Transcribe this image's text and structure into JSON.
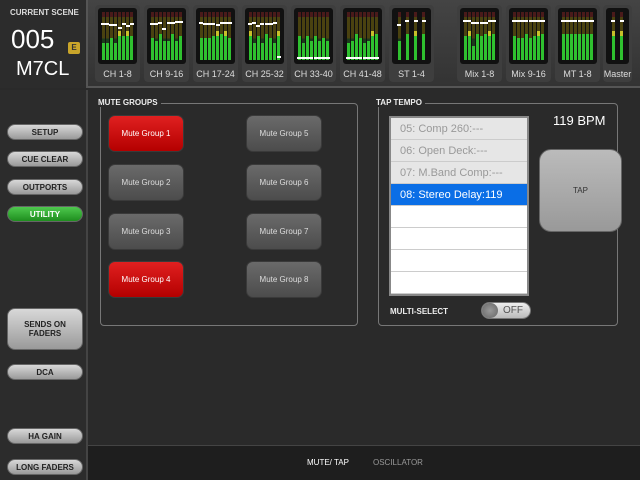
{
  "scene": {
    "label": "CURRENT SCENE",
    "number": "005",
    "badge": "E",
    "name": "M7CL"
  },
  "meters": [
    {
      "label": "CH 1-8",
      "levels": [
        0.35,
        0.35,
        0.45,
        0.35,
        0.6,
        0.5,
        0.6,
        0.5
      ],
      "faders": [
        0.72,
        0.72,
        0.7,
        0.7,
        0.65,
        0.72,
        0.68,
        0.72
      ]
    },
    {
      "label": "CH 9-16",
      "levels": [
        0.45,
        0.4,
        0.55,
        0.4,
        0.4,
        0.55,
        0.4,
        0.5
      ],
      "faders": [
        0.72,
        0.72,
        0.74,
        0.62,
        0.74,
        0.74,
        0.78,
        0.78
      ]
    },
    {
      "label": "CH 17-24",
      "levels": [
        0.45,
        0.45,
        0.45,
        0.5,
        0.6,
        0.55,
        0.6,
        0.45
      ],
      "faders": [
        0.74,
        0.72,
        0.72,
        0.72,
        0.7,
        0.74,
        0.76,
        0.74
      ]
    },
    {
      "label": "CH 25-32",
      "levels": [
        0.6,
        0.35,
        0.5,
        0.35,
        0.55,
        0.45,
        0.35,
        0.6
      ],
      "faders": [
        0.72,
        0.74,
        0.68,
        0.72,
        0.72,
        0.72,
        0.74,
        0.05
      ]
    },
    {
      "label": "CH 33-40",
      "levels": [
        0.5,
        0.35,
        0.5,
        0.4,
        0.5,
        0.4,
        0.45,
        0.4
      ],
      "faders": [
        0.02,
        0.02,
        0.02,
        0.02,
        0.02,
        0.02,
        0.02,
        0.02
      ]
    },
    {
      "label": "CH 41-48",
      "levels": [
        0.35,
        0.4,
        0.55,
        0.45,
        0.35,
        0.4,
        0.6,
        0.55
      ],
      "faders": [
        0.02,
        0.02,
        0.02,
        0.02,
        0.02,
        0.02,
        0.02,
        0.02
      ]
    },
    {
      "label": "ST 1-4",
      "levels": [
        0.4,
        0.55,
        0.6,
        0.55
      ],
      "faders": [
        0.7,
        0.8,
        0.8,
        0.8
      ]
    },
    {
      "label": "Mix 1-8",
      "levels": [
        0.5,
        0.6,
        0.3,
        0.55,
        0.5,
        0.55,
        0.6,
        0.55
      ],
      "faders": [
        0.8,
        0.8,
        0.75,
        0.75,
        0.75,
        0.76,
        0.8,
        0.8
      ]
    },
    {
      "label": "Mix 9-16",
      "levels": [
        0.5,
        0.45,
        0.45,
        0.55,
        0.45,
        0.5,
        0.6,
        0.55
      ],
      "faders": [
        0.8,
        0.8,
        0.8,
        0.8,
        0.8,
        0.8,
        0.8,
        0.8
      ]
    },
    {
      "label": "MT 1-8",
      "levels": [
        0.55,
        0.55,
        0.55,
        0.55,
        0.55,
        0.55,
        0.55,
        0.55
      ],
      "faders": [
        0.8,
        0.8,
        0.8,
        0.8,
        0.8,
        0.8,
        0.8,
        0.8
      ]
    },
    {
      "label": "Master",
      "levels": [
        0.6,
        0.6
      ],
      "faders": [
        0.8,
        0.8
      ]
    }
  ],
  "sidebar": {
    "setup": "SETUP",
    "cue_clear": "CUE CLEAR",
    "outports": "OUTPORTS",
    "utility": "UTILITY",
    "sends_on_faders": "SENDS ON FADERS",
    "dca": "DCA",
    "ha_gain": "HA GAIN",
    "long_faders": "LONG FADERS"
  },
  "mute_groups": {
    "title": "MUTE GROUPS",
    "buttons": [
      {
        "label": "Mute Group 1",
        "on": true
      },
      {
        "label": "Mute Group 2",
        "on": false
      },
      {
        "label": "Mute Group 3",
        "on": false
      },
      {
        "label": "Mute Group 4",
        "on": true
      },
      {
        "label": "Mute Group 5",
        "on": false
      },
      {
        "label": "Mute Group 6",
        "on": false
      },
      {
        "label": "Mute Group 7",
        "on": false
      },
      {
        "label": "Mute Group 8",
        "on": false
      }
    ]
  },
  "tap_tempo": {
    "title": "TAP TEMPO",
    "bpm": "119 BPM",
    "tap_label": "TAP",
    "multi_select_label": "MULTI-SELECT",
    "multi_select_state": "OFF",
    "items": [
      "05: Comp 260:---",
      "06: Open Deck:---",
      "07: M.Band Comp:---",
      "08: Stereo Delay:119"
    ],
    "selected_index": 3
  },
  "bottom_tabs": {
    "mute_tap": "MUTE/ TAP",
    "oscillator": "OSCILLATOR"
  },
  "colors": {
    "mute_on": "#d01010",
    "utility_active": "#2ea82e",
    "list_selected": "#0a6ee6",
    "meter_green": "#2fc12f"
  }
}
